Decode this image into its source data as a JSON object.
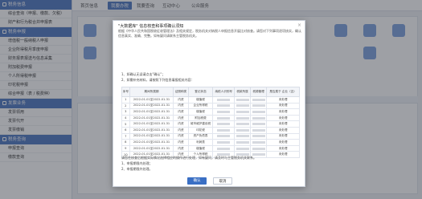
{
  "sidebar": {
    "sections": [
      {
        "title": "税务信息",
        "items": [
          "综合查询（申报、缴款、欠税）",
          "财产和行为税合并申报表"
        ]
      },
      {
        "title": "税务申报",
        "items": [
          "增值税一般纳税人申报",
          "企业所得税月季度申报",
          "财务报表报送与信息采集",
          "附加税费申报",
          "个人所得税申报",
          "印花税申报",
          "综合申报（表 / 税费种）"
        ]
      },
      {
        "title": "发票业务",
        "items": [
          "发票领用",
          "发票代开",
          "发票缴销"
        ]
      },
      {
        "title": "税务查询",
        "items": [
          "申报查询",
          "缴款查询"
        ]
      }
    ]
  },
  "tabs": [
    "首页信息",
    "我要办税",
    "我要查询",
    "互动中心",
    "公众服务"
  ],
  "modal": {
    "title": "\"大数据库\" 信息核查和事项确认须知",
    "paragraph": "根据《中华人民共和国税收征收管理法》及相关规定，税务机关对纳税人申报信息开展比对核查。请您对下列事项逐项核实，确认信息真实、准确、完整。如有疑问请联系主管税务机关。",
    "steps": [
      "1、如确认无误请点击\"确认\"；",
      "2、如需补充材料，请按照下列信息填报相关内容："
    ],
    "table_headers": [
      "序号",
      "期间所属期",
      "证照种类",
      "登记状态",
      "纳税人识别号",
      "税款所属",
      "税源管理",
      "是否属于\n企业（否）"
    ],
    "rows": [
      {
        "n": "1",
        "period": "2022-01-01至2022-01-31",
        "kind": "内资",
        "status": "增值税",
        "flag": "未处理"
      },
      {
        "n": "2",
        "period": "2022-01-01至2022-01-31",
        "kind": "内资",
        "status": "企业所得税",
        "flag": "未处理"
      },
      {
        "n": "3",
        "period": "2022-01-01至2022-01-31",
        "kind": "内资",
        "status": "增值税",
        "flag": "未处理"
      },
      {
        "n": "4",
        "period": "2022-01-01至2022-01-31",
        "kind": "内资",
        "status": "附加税费",
        "flag": "未处理"
      },
      {
        "n": "5",
        "period": "2022-01-01至2022-01-31",
        "kind": "内资",
        "status": "城市维护建设税",
        "flag": "未处理"
      },
      {
        "n": "6",
        "period": "2022-01-01至2022-01-31",
        "kind": "内资",
        "status": "印花税",
        "flag": "未处理"
      },
      {
        "n": "7",
        "period": "2022-01-01至2022-01-31",
        "kind": "内资",
        "status": "资产负债表",
        "flag": "未处理"
      },
      {
        "n": "8",
        "period": "2022-01-01至2022-01-31",
        "kind": "内资",
        "status": "利润表",
        "flag": "未处理"
      },
      {
        "n": "9",
        "period": "2022-01-01至2022-01-31",
        "kind": "内资",
        "status": "增值税",
        "flag": "未处理"
      },
      {
        "n": "10",
        "period": "2022-01-01至2022-01-31",
        "kind": "内资",
        "status": "个人所得税",
        "flag": "未处理"
      }
    ],
    "footer": [
      "请您在核查后根据实际情况选择相应的操作进行处理，如有疑问，请及时与主管税务机关联系。",
      "1、申报期限内处理；",
      "2、申报期限外处理。"
    ],
    "confirm_label": "确认",
    "cancel_label": "取消",
    "close_label": "×"
  }
}
